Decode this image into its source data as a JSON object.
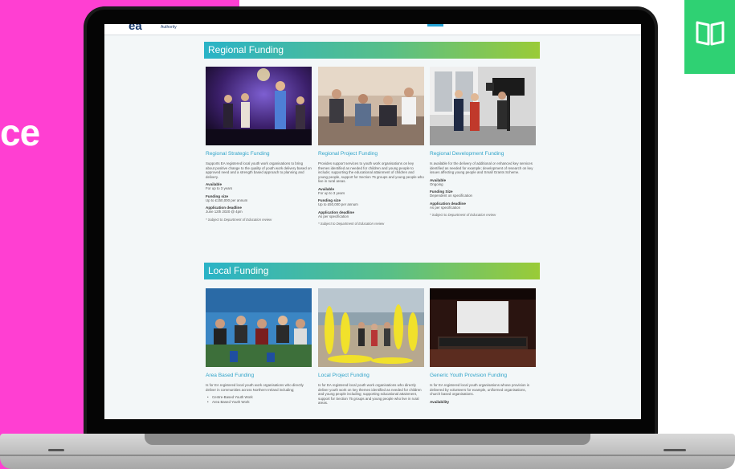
{
  "side_text": "ce",
  "logo": {
    "text": "ea",
    "sub": "Authority"
  },
  "regional": {
    "heading": "Regional Funding",
    "cards": [
      {
        "title": "Regional Strategic Funding",
        "desc": "Supports EA registered local youth work organisations to bring about positive change to the quality of youth work delivery based on approved need and a strength based approach to planning and delivery.",
        "available_label": "Available",
        "available": "For up to 3 years",
        "size_label": "Funding size",
        "size": "Up to £150,000 per annum",
        "deadline_label": "Application deadline",
        "deadline": "June 12th 2020 @ 4pm",
        "note": "* Subject to Department of Education review"
      },
      {
        "title": "Regional Project Funding",
        "desc": "Provides support services to youth work organisations on key themes identified as needed for children and young people to include; supporting the educational attainment of children and young people, support for Section 75 groups and young people who live in rural areas.",
        "available_label": "Available",
        "available": "For up to 3 years",
        "size_label": "Funding size",
        "size": "Up to £50,000 per annum",
        "deadline_label": "Application deadline",
        "deadline": "As per specification",
        "note": "* Subject to Department of Education review"
      },
      {
        "title": "Regional Development Funding",
        "desc": "Is available for the delivery of additional or enhanced key services identified as needed for example; development of research on key issues affecting young people and Small Grants Scheme.",
        "available_label": "Available",
        "available": "Ongoing",
        "size_label": "Funding Size",
        "size": "Dependent on specification",
        "deadline_label": "Application deadline",
        "deadline": "As per specification",
        "note": "* Subject to Department of Education review"
      }
    ]
  },
  "local": {
    "heading": "Local Funding",
    "cards": [
      {
        "title": "Area Based Funding",
        "desc": "Is for EA registered local youth work organisations who directly deliver in communities across Northern Ireland including;",
        "bullets": [
          "Centre-Based Youth Work",
          "Area Based Youth Work"
        ]
      },
      {
        "title": "Local Project Funding",
        "desc": "Is for EA registered local youth work organisations who directly deliver youth work on key themes identified as needed for children and young people including; supporting educational attainment, support for Section 75 groups and young people who live in rural areas."
      },
      {
        "title": "Generic Youth Provision Funding",
        "desc": "Is for EA registered local youth organisations whose provision is delivered by volunteers for example, uniformed organisations, church based organisations.",
        "available_label": "Availability"
      }
    ]
  },
  "colors": {
    "magenta": "#ff3fd2",
    "green_tile": "#2fd173",
    "link": "#2fa3c9",
    "banner_start": "#2ab3c7",
    "banner_end": "#9acb37"
  },
  "icons": [
    "book-icon"
  ]
}
